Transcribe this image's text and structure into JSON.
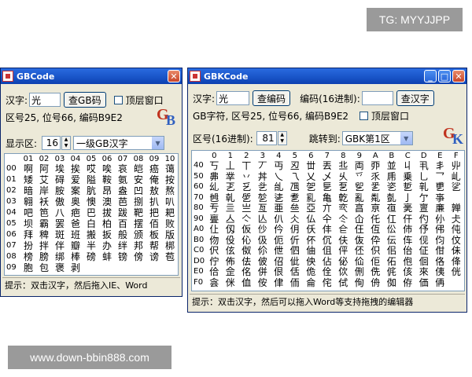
{
  "watermarks": {
    "top": "TG: MYYJJPP",
    "bottom": "www.down-bbin888.com"
  },
  "left_window": {
    "title": "GBCode",
    "hanzi_label": "汉字:",
    "hanzi_value": "光",
    "check_button": "查GB码",
    "topmost_label": "顶层窗口",
    "info": "区号25, 位号66, 编码B9E2",
    "zone_label": "显示区:",
    "zone_value": "16",
    "level_select": "一级GB汉字",
    "col_headers": [
      "01",
      "02",
      "03",
      "04",
      "05",
      "06",
      "07",
      "08",
      "09",
      "10"
    ],
    "row_labels": [
      "00",
      "01",
      "02",
      "03",
      "04",
      "05",
      "06",
      "07",
      "08",
      "09"
    ],
    "grid": [
      [
        "啊",
        "阿",
        "埃",
        "挨",
        "哎",
        "唉",
        "哀",
        "皑",
        "癌",
        "蔼"
      ],
      [
        "矮",
        "艾",
        "碍",
        "爱",
        "隘",
        "鞍",
        "氨",
        "安",
        "俺",
        "按"
      ],
      [
        "暗",
        "岸",
        "胺",
        "案",
        "肮",
        "昂",
        "盎",
        "凹",
        "敖",
        "熬"
      ],
      [
        "翱",
        "袄",
        "傲",
        "奥",
        "懊",
        "澳",
        "芭",
        "捌",
        "扒",
        "叭"
      ],
      [
        "吧",
        "笆",
        "八",
        "疤",
        "巴",
        "拔",
        "跋",
        "靶",
        "把",
        "耙"
      ],
      [
        "坝",
        "霸",
        "罢",
        "爸",
        "白",
        "柏",
        "百",
        "摆",
        "佰",
        "败"
      ],
      [
        "拜",
        "稗",
        "斑",
        "班",
        "搬",
        "扳",
        "般",
        "颁",
        "板",
        "版"
      ],
      [
        "扮",
        "拌",
        "伴",
        "瓣",
        "半",
        "办",
        "绊",
        "邦",
        "帮",
        "梆"
      ],
      [
        "榜",
        "膀",
        "绑",
        "棒",
        "磅",
        "蚌",
        "镑",
        "傍",
        "谤",
        "苞"
      ],
      [
        "胞",
        "包",
        "褒",
        "剥",
        "",
        "",
        "",
        "",
        "",
        ""
      ]
    ],
    "status": "提示：双击汉字，然后拖入IE、Word"
  },
  "right_window": {
    "title": "GBKCode",
    "hanzi_label": "汉字:",
    "hanzi_value": "光",
    "check_button": "查编码",
    "code_label": "编码(16进制):",
    "code_value": "",
    "check_char_button": "查汉字",
    "info": "GB字符, 区号25, 位号66, 编码B9E2",
    "topmost_label": "顶层窗口",
    "zone_label": "区号(16进制):",
    "zone_value": "81",
    "jump_label": "跳转到:",
    "jump_select": "GBK第1区",
    "col_headers": [
      "0",
      "1",
      "2",
      "3",
      "4",
      "5",
      "6",
      "7",
      "8",
      "9",
      "A",
      "B",
      "C",
      "D",
      "E",
      "F"
    ],
    "row_labels": [
      "40",
      "50",
      "60",
      "70",
      "80",
      "90",
      "A0",
      "B0",
      "C0",
      "D0",
      "E0",
      "F0"
    ],
    "grid": [
      [
        "丂",
        "丄",
        "丅",
        "丆",
        "丏",
        "丒",
        "丗",
        "丟",
        "丠",
        "両",
        "丣",
        "並",
        "丩",
        "丮",
        "丯",
        "丱"
      ],
      [
        "丳",
        "丵",
        "丷",
        "丼",
        "乀",
        "乁",
        "乂",
        "乄",
        "乆",
        "乊",
        "乑",
        "乕",
        "乗",
        "乚",
        "乛",
        "乢"
      ],
      [
        "乣",
        "乤",
        "乥",
        "乧",
        "乨",
        "乪",
        "乫",
        "乬",
        "乭",
        "乮",
        "乯",
        "乲",
        "乴",
        "乵",
        "乶",
        "乷"
      ],
      [
        "乸",
        "乹",
        "乺",
        "乻",
        "乼",
        "乽",
        "乿",
        "亀",
        "亁",
        "亂",
        "亃",
        "亄",
        "亅",
        "亇",
        "亊",
        ""
      ],
      [
        "亐",
        "亖",
        "亗",
        "亙",
        "亜",
        "亝",
        "亞",
        "亣",
        "亪",
        "亯",
        "亰",
        "亱",
        "亴",
        "亶",
        "亷",
        "亸"
      ],
      [
        "亹",
        "亼",
        "亽",
        "亾",
        "仈",
        "仌",
        "仏",
        "仐",
        "仒",
        "仚",
        "仛",
        "仜",
        "仠",
        "仢",
        "仦",
        "仧"
      ],
      [
        "仩",
        "仭",
        "仮",
        "仯",
        "仱",
        "仴",
        "仸",
        "仹",
        "仺",
        "仼",
        "仾",
        "伀",
        "伂",
        "伃",
        "伄",
        "伅"
      ],
      [
        "伆",
        "伇",
        "伈",
        "伋",
        "伌",
        "伒",
        "伓",
        "伔",
        "伕",
        "伖",
        "伜",
        "伝",
        "伡",
        "伣",
        "伨",
        "伩"
      ],
      [
        "伬",
        "伭",
        "伮",
        "伱",
        "伳",
        "伵",
        "伷",
        "伹",
        "伻",
        "伾",
        "伿",
        "佀",
        "佁",
        "佂",
        "佄",
        "佅"
      ],
      [
        "佇",
        "佈",
        "佉",
        "佊",
        "佋",
        "佌",
        "佒",
        "佔",
        "佖",
        "佡",
        "佢",
        "佦",
        "佨",
        "佪",
        "佫",
        "佭"
      ],
      [
        "佮",
        "佱",
        "佲",
        "併",
        "佷",
        "佸",
        "佹",
        "佺",
        "佽",
        "侀",
        "侁",
        "侂",
        "侅",
        "來",
        "侇",
        "侊"
      ],
      [
        "侌",
        "侎",
        "侐",
        "侒",
        "侓",
        "侕",
        "侖",
        "侘",
        "侙",
        "侚",
        "侜",
        "侞",
        "侟",
        "価",
        "侢",
        ""
      ]
    ],
    "status": "提示：双击汉字，然后可以拖入Word等支持拖拽的编辑器"
  }
}
